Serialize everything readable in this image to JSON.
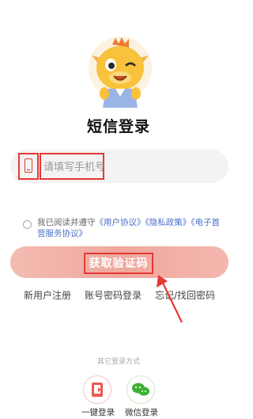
{
  "page": {
    "title": "短信登录"
  },
  "phone": {
    "placeholder": "请填写手机号",
    "value": ""
  },
  "agreement": {
    "prefix": "我已阅读并遵守",
    "user_agreement": "《用户协议》",
    "privacy_policy": "《隐私政策》",
    "telecom_service": "《电子首营服务协议》"
  },
  "primary_button": {
    "label": "获取验证码"
  },
  "links": {
    "register": "新用户注册",
    "password_login": "账号密码登录",
    "forgot_password": "忘记/找回密码"
  },
  "other_methods": {
    "title": "其它登录方式",
    "items": [
      {
        "label": "一键登录",
        "icon": "phone-login-icon"
      },
      {
        "label": "微信登录",
        "icon": "wechat-icon"
      }
    ]
  },
  "colors": {
    "accent": "#f0a79e",
    "highlight": "#e53935",
    "link": "#4a6fc8"
  }
}
